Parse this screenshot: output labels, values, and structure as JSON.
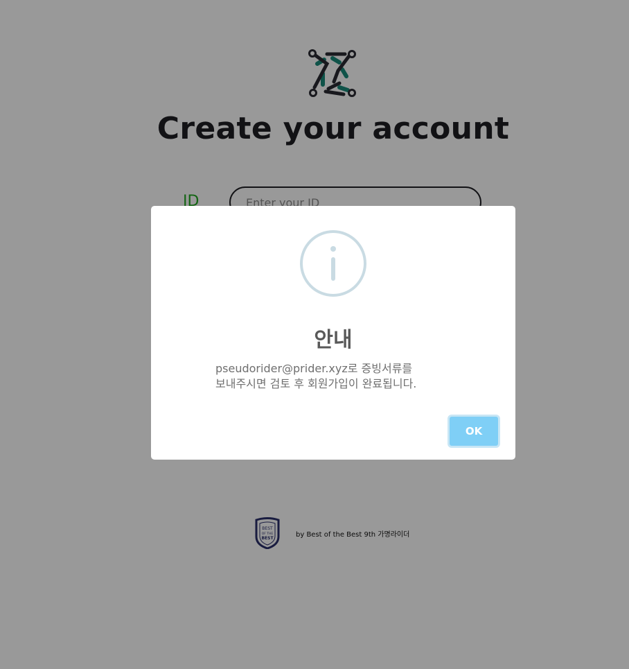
{
  "page": {
    "title": "Create your account",
    "logo_icon": "circuit-logo-icon",
    "form": {
      "id_label": "ID",
      "id_placeholder": "Enter your ID"
    },
    "footer": {
      "badge_icon": "best-of-the-best-badge-icon",
      "badge_lines": [
        "BEST",
        "OF THE",
        "BEST"
      ],
      "credit": "by Best of the Best 9th 가명라이더"
    }
  },
  "dialog": {
    "icon": "info-icon",
    "title": "안내",
    "message_line1": "pseudorider@prider.xyz로 증빙서류를",
    "message_line2": "보내주시면 검토 후 회원가입이 완료됩니다.",
    "ok_label": "OK"
  },
  "colors": {
    "accent_green": "#22a822",
    "logo_teal": "#1a8a7a",
    "logo_dark": "#2b2b33",
    "ok_button": "#7fcff6",
    "info_icon": "#c9dbe3"
  }
}
